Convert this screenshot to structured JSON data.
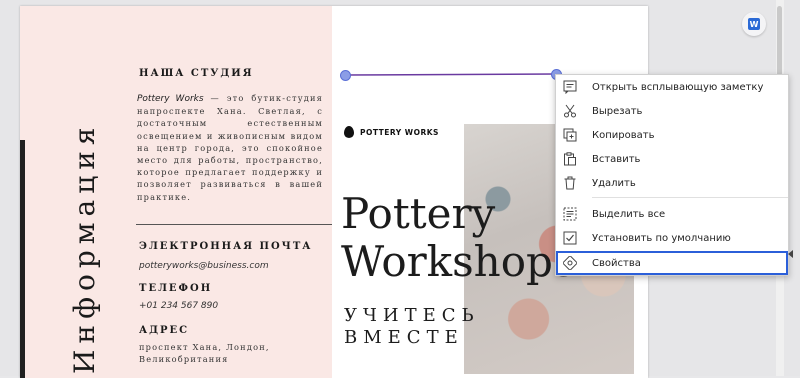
{
  "document": {
    "vertical_title": "Информация",
    "studio_heading": "НАША СТУДИЯ",
    "studio_brand": "Pottery Works",
    "studio_text": " — это бутик-студия напроспекте Хана. Светлая, с достаточным естественным освещением и живописным видом на центр города, это спокойное место для работы, пространство, которое предлагает поддержку и позволяет развиваться в вашей практике.",
    "email_heading": "ЭЛЕКТРОННАЯ ПОЧТА",
    "email_value": "potteryworks@business.com",
    "phone_heading": "ТЕЛЕФОН",
    "phone_value": "+01 234 567 890",
    "address_heading": "АДРЕС",
    "address_value": "проспект Хана, Лондон, Великобритания",
    "brand_name": "POTTERY WORKS",
    "title_line1": "Pottery",
    "title_line2": "Workshops",
    "subtitle_line1": "УЧИТЕСЬ",
    "subtitle_line2": "ВМЕСТЕ"
  },
  "context_menu": {
    "items": [
      {
        "label": "Открыть всплывающую заметку",
        "icon": "note-icon"
      },
      {
        "label": "Вырезать",
        "icon": "scissors-icon"
      },
      {
        "label": "Копировать",
        "icon": "copy-icon"
      },
      {
        "label": "Вставить",
        "icon": "paste-icon"
      },
      {
        "label": "Удалить",
        "icon": "trash-icon"
      },
      {
        "label": "Выделить все",
        "icon": "select-all-icon"
      },
      {
        "label": "Установить по умолчанию",
        "icon": "checkbox-icon"
      },
      {
        "label": "Свойства",
        "icon": "properties-icon"
      }
    ],
    "selected_label": "Свойства"
  },
  "toolbar": {
    "corner_button_glyph": "W"
  },
  "colors": {
    "accent": "#2b5fd9",
    "annotation_line": "#6a3aa0",
    "left_panel_bg": "#fae8e5"
  }
}
